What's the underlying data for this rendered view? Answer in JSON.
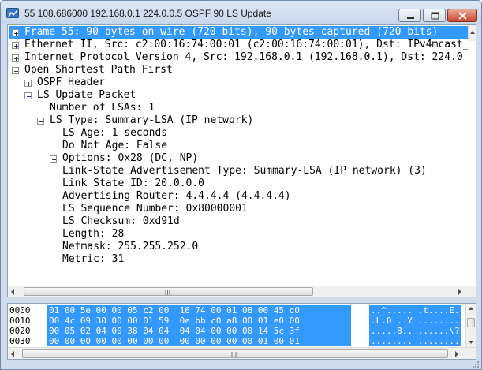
{
  "window": {
    "title": "55 108.686000 192.168.0.1 224.0.0.5 OSPF 90 LS Update",
    "accent_color": "#3399ff"
  },
  "tree": {
    "rows": [
      {
        "text": "Frame 55: 90 bytes on wire (720 bits), 90 bytes captured (720 bits)",
        "expander": "plus",
        "selected": true
      },
      {
        "text": "Ethernet II, Src: c2:00:16:74:00:01 (c2:00:16:74:00:01), Dst: IPv4mcast_",
        "expander": "plus",
        "selected": false
      },
      {
        "text": "Internet Protocol Version 4, Src: 192.168.0.1 (192.168.0.1), Dst: 224.0",
        "expander": "plus",
        "selected": false
      },
      {
        "text": "Open Shortest Path First",
        "expander": "minus",
        "selected": false
      },
      {
        "text": "OSPF Header",
        "expander": "plus",
        "selected": false
      },
      {
        "text": "LS Update Packet",
        "expander": "minus",
        "selected": false
      },
      {
        "text": "Number of LSAs: 1",
        "expander": "none",
        "selected": false
      },
      {
        "text": "LS Type: Summary-LSA (IP network)",
        "expander": "minus",
        "selected": false
      },
      {
        "text": "LS Age: 1 seconds",
        "expander": "none",
        "selected": false
      },
      {
        "text": "Do Not Age: False",
        "expander": "none",
        "selected": false
      },
      {
        "text": "Options: 0x28 (DC, NP)",
        "expander": "plus",
        "selected": false
      },
      {
        "text": "Link-State Advertisement Type: Summary-LSA (IP network) (3)",
        "expander": "none",
        "selected": false
      },
      {
        "text": "Link State ID: 20.0.0.0",
        "expander": "none",
        "selected": false
      },
      {
        "text": "Advertising Router: 4.4.4.4 (4.4.4.4)",
        "expander": "none",
        "selected": false
      },
      {
        "text": "LS Sequence Number: 0x80000001",
        "expander": "none",
        "selected": false
      },
      {
        "text": "LS Checksum: 0xd91d",
        "expander": "none",
        "selected": false
      },
      {
        "text": "Length: 28",
        "expander": "none",
        "selected": false
      },
      {
        "text": "Netmask: 255.255.252.0",
        "expander": "none",
        "selected": false
      },
      {
        "text": "Metric: 31",
        "expander": "none",
        "selected": false
      }
    ]
  },
  "hex": {
    "lines": [
      {
        "offset": "0000",
        "bytes": "01 00 5e 00 00 05 c2 00  16 74 00 01 08 00 45 c0",
        "ascii": "..^..... .t....E."
      },
      {
        "offset": "0010",
        "bytes": "00 4c 09 30 00 00 01 59  0e bb c0 a8 00 01 e0 00",
        "ascii": ".L.0...Y ........"
      },
      {
        "offset": "0020",
        "bytes": "00 05 02 04 00 38 04 04  04 04 00 00 00 14 5c 3f",
        "ascii": ".....8.. ......\\?"
      },
      {
        "offset": "0030",
        "bytes": "00 00 00 00 00 00 00 00  00 00 00 00 00 01 00 01",
        "ascii": "........ ........"
      }
    ]
  }
}
